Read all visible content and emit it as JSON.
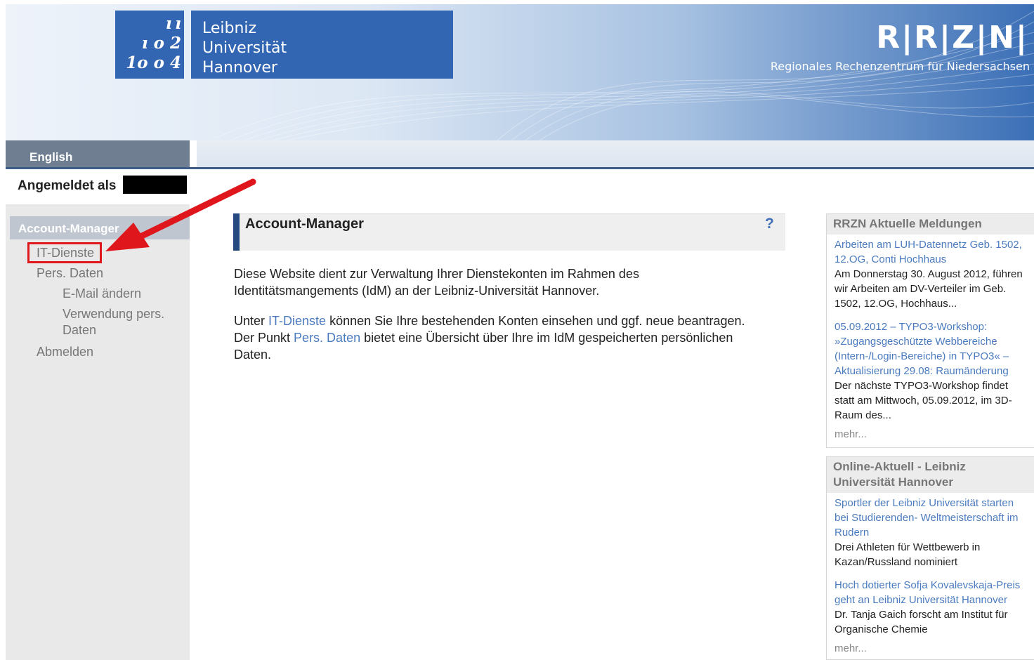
{
  "header": {
    "logo_glyphs": [
      " ı ı",
      "ı o 2",
      "1o o 4"
    ],
    "university_lines": [
      "Leibniz",
      "Universität",
      "Hannover"
    ],
    "rrzn_logo": "R|R|Z|N|",
    "rrzn_subtitle": "Regionales Rechenzentrum für Niedersachsen"
  },
  "nav": {
    "language_link": "English"
  },
  "sidebar": {
    "logged_in_label": "Angemeldet als",
    "section_title": "Account-Manager",
    "items": [
      {
        "label": "IT-Dienste"
      },
      {
        "label": "Pers. Daten"
      },
      {
        "label": "E-Mail ändern"
      },
      {
        "label_line1": "Verwendung pers.",
        "label_line2": "Daten"
      },
      {
        "label": "Abmelden"
      }
    ]
  },
  "main": {
    "title": "Account-Manager",
    "help": "?",
    "para1_line1": "Diese Website dient zur Verwaltung Ihrer Dienstekonten im Rahmen des",
    "para1_line2": "Identitätsmangements (IdM) an der Leibniz-Universität Hannover.",
    "para2_prefix": "Unter ",
    "para2_link1": "IT-Dienste",
    "para2_mid1": " können Sie Ihre bestehenden Konten einsehen und ggf. neue beantragen.",
    "para2_line2_prefix": "Der Punkt ",
    "para2_link2": "Pers. Daten",
    "para2_line2_suffix": " bietet eine Übersicht über Ihre im IdM gespeicherten persönlichen",
    "para2_line3": "Daten."
  },
  "news1": {
    "heading": "RRZN Aktuelle Meldungen",
    "items": [
      {
        "link": "Arbeiten am LUH-Datennetz Geb. 1502, 12.OG, Conti Hochhaus",
        "text": "Am Donnerstag 30. August 2012, führen wir Arbeiten am DV-Verteiler im Geb. 1502, 12.OG, Hochhaus..."
      },
      {
        "link": "05.09.2012 – TYPO3-Workshop: »Zugangsgeschützte Webbereiche (Intern-/Login-Bereiche) in TYPO3« – Aktualisierung 29.08: Raumänderung",
        "text": "Der nächste TYPO3-Workshop findet statt am Mittwoch, 05.09.2012, im 3D-Raum des..."
      }
    ],
    "more": "mehr..."
  },
  "news2": {
    "heading": "Online-Aktuell - Leibniz Universität Hannover",
    "items": [
      {
        "link": "Sportler der Leibniz Universität starten bei Studierenden- Weltmeisterschaft im Rudern",
        "text": "Drei Athleten für Wettbewerb in Kazan/Russland nominiert"
      },
      {
        "link": "Hoch dotierter Sofja Kovalevskaja-Preis geht an Leibniz Universität Hannover",
        "text": "Dr. Tanja Gaich forscht am Institut für Organische Chemie"
      }
    ],
    "more": "mehr..."
  },
  "colors": {
    "brand_blue": "#3266b2",
    "nav_gray": "#6f7f91",
    "link_blue": "#4b7bbf",
    "annotation_red": "#e0161d"
  }
}
